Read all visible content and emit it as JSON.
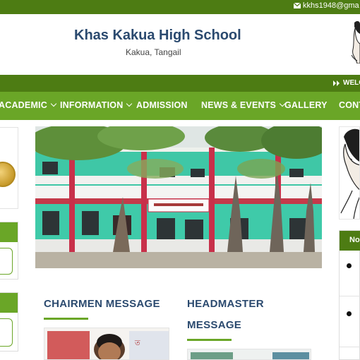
{
  "topbar": {
    "email": "kkhs1948@gma",
    "email_icon": "envelope-icon"
  },
  "header": {
    "school_name": "Khas Kakua High School",
    "location": "Kakua, Tangail"
  },
  "ticker": {
    "text": "WELCO",
    "icon": "double-chevron-right-icon"
  },
  "nav": {
    "items": [
      {
        "label": "ACADEMIC",
        "dropdown": true
      },
      {
        "label": "INFORMATION",
        "dropdown": true
      },
      {
        "label": "ADMISSION",
        "dropdown": false
      },
      {
        "label": "NEWS & EVENTS",
        "dropdown": true
      },
      {
        "label": "GALLERY",
        "dropdown": false
      },
      {
        "label": "CONT",
        "dropdown": false
      }
    ]
  },
  "sections": {
    "chairmen": "CHAIRMEN MESSAGE",
    "headmaster_line1": "HEADMASTER",
    "headmaster_line2": "MESSAGE"
  },
  "notice": {
    "heading": "No"
  },
  "colors": {
    "dark_green": "#4d7c13",
    "nav_green": "#6aa627",
    "title_blue": "#2b4a6f"
  }
}
